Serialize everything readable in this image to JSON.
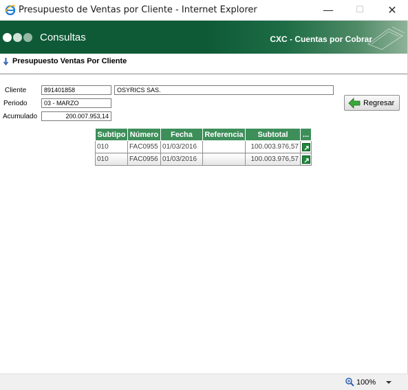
{
  "window": {
    "title": "Presupuesto de Ventas por Cliente - Internet Explorer",
    "minimize_glyph": "—",
    "maximize_glyph": "☐",
    "close_glyph": "✕"
  },
  "banner": {
    "section_title": "Consultas",
    "module_title": "CXC - Cuentas por Cobrar",
    "brand_color": "#0e5a37"
  },
  "page": {
    "title": "Presupuesto Ventas Por Cliente"
  },
  "form": {
    "cliente_label": "Cliente",
    "cliente_code": "891401858",
    "cliente_name": "OSYRICS SAS.",
    "periodo_label": "Periodo",
    "periodo_value": "03 - MARZO",
    "acumulado_label": "Acumulado",
    "acumulado_value": "200.007.953,14"
  },
  "actions": {
    "regresar_label": "Regresar"
  },
  "grid": {
    "header_color": "#3e8e5a",
    "columns": [
      "Subtipo",
      "Número",
      "Fecha",
      "Referencia",
      "Subtotal",
      "..."
    ],
    "rows": [
      {
        "subtipo": "010",
        "numero": "FAC0955",
        "fecha": "01/03/2016",
        "referencia": "",
        "subtotal": "100.003.976,57",
        "action_icon": "open-link-icon"
      },
      {
        "subtipo": "010",
        "numero": "FAC0956",
        "fecha": "01/03/2016",
        "referencia": "",
        "subtotal": "100.003.976,57",
        "action_icon": "open-link-icon"
      }
    ]
  },
  "statusbar": {
    "zoom": "100%"
  }
}
